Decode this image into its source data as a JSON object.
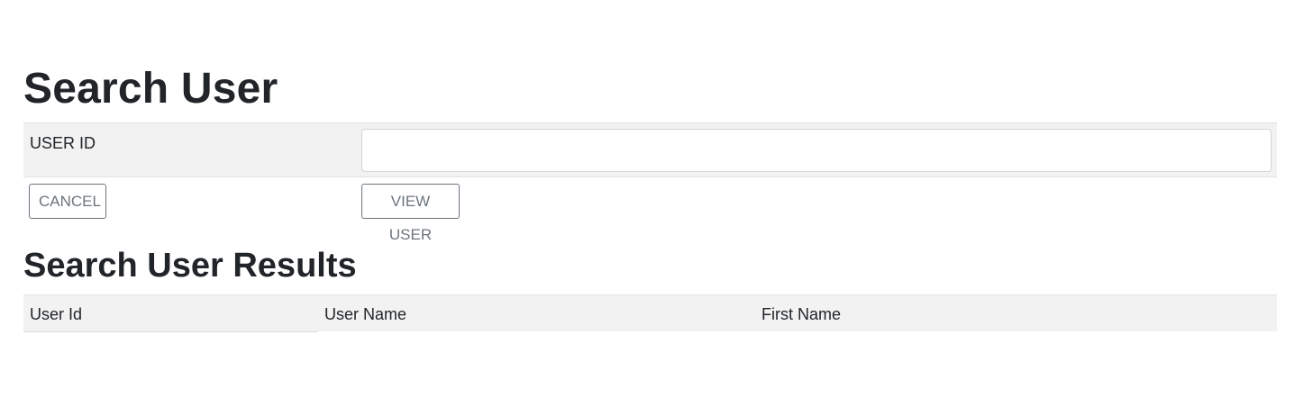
{
  "page": {
    "title": "Search User",
    "results_title": "Search User Results"
  },
  "form": {
    "user_id_label": "USER ID",
    "user_id_value": "",
    "user_id_placeholder": ""
  },
  "buttons": {
    "cancel_label": "CANCEL",
    "view_user_label": "VIEW USER"
  },
  "results": {
    "columns": [
      "User Id",
      "User Name",
      "First Name"
    ],
    "rows": []
  },
  "colors": {
    "text": "#212529",
    "row_background": "#f2f2f2",
    "button_outline": "#6c757d"
  }
}
